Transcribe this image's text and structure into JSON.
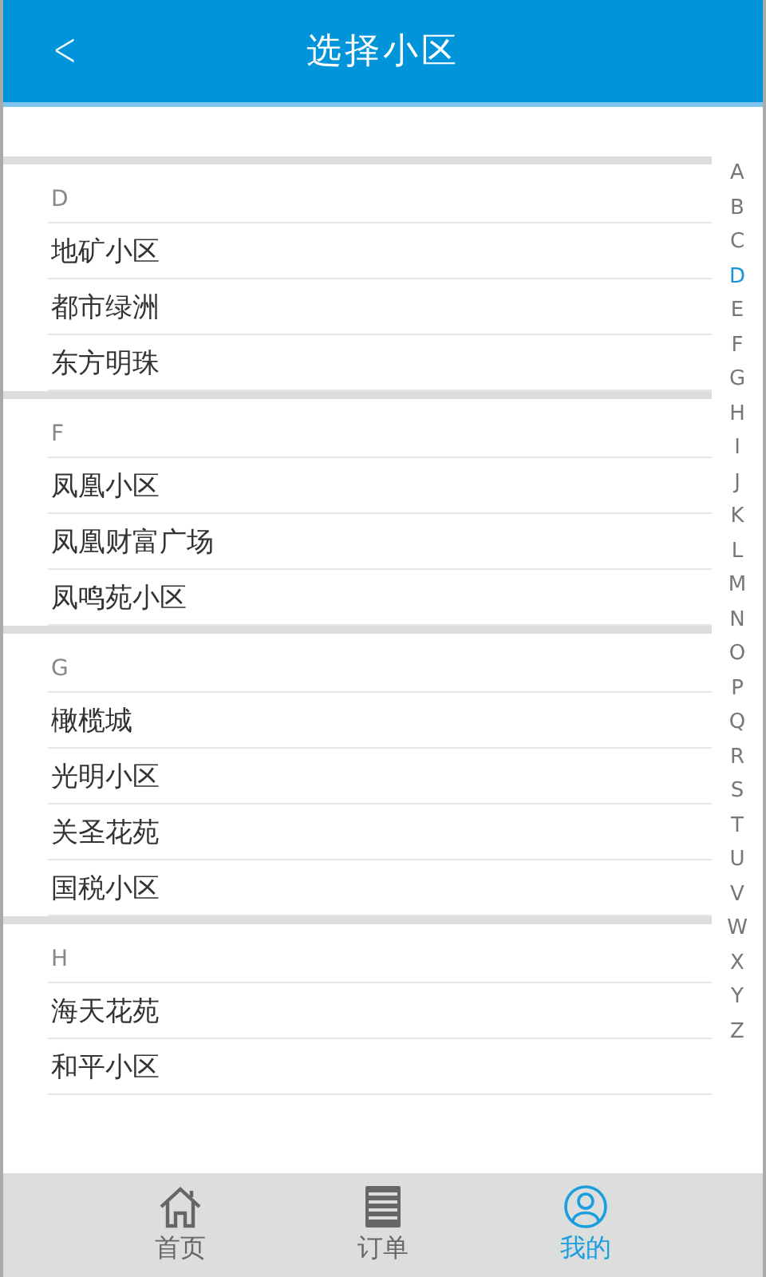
{
  "header": {
    "back": "<",
    "title": "选择小区"
  },
  "sections": [
    {
      "letter": "D",
      "items": [
        "地矿小区",
        "都市绿洲",
        "东方明珠"
      ]
    },
    {
      "letter": "F",
      "items": [
        "凤凰小区",
        "凤凰财富广场",
        "凤鸣苑小区"
      ]
    },
    {
      "letter": "G",
      "items": [
        "橄榄城",
        "光明小区",
        "关圣花苑",
        "国税小区"
      ]
    },
    {
      "letter": "H",
      "items": [
        "海天花苑",
        "和平小区"
      ]
    }
  ],
  "index": [
    {
      "letter": "A",
      "selected": false
    },
    {
      "letter": "B",
      "selected": false
    },
    {
      "letter": "C",
      "selected": false
    },
    {
      "letter": "D",
      "selected": true
    },
    {
      "letter": "E",
      "selected": false
    },
    {
      "letter": "F",
      "selected": false
    },
    {
      "letter": "G",
      "selected": false
    },
    {
      "letter": "H",
      "selected": false
    },
    {
      "letter": "I",
      "selected": false
    },
    {
      "letter": "J",
      "selected": false
    },
    {
      "letter": "K",
      "selected": false
    },
    {
      "letter": "L",
      "selected": false
    },
    {
      "letter": "M",
      "selected": false
    },
    {
      "letter": "N",
      "selected": false
    },
    {
      "letter": "O",
      "selected": false
    },
    {
      "letter": "P",
      "selected": false
    },
    {
      "letter": "Q",
      "selected": false
    },
    {
      "letter": "R",
      "selected": false
    },
    {
      "letter": "S",
      "selected": false
    },
    {
      "letter": "T",
      "selected": false
    },
    {
      "letter": "U",
      "selected": false
    },
    {
      "letter": "V",
      "selected": false
    },
    {
      "letter": "W",
      "selected": false
    },
    {
      "letter": "X",
      "selected": false
    },
    {
      "letter": "Y",
      "selected": false
    },
    {
      "letter": "Z",
      "selected": false
    }
  ],
  "tabs": [
    {
      "kind": "home",
      "label": "首页",
      "selected": false
    },
    {
      "kind": "list",
      "label": "订单",
      "selected": false
    },
    {
      "kind": "person",
      "label": "我的",
      "selected": true
    }
  ]
}
